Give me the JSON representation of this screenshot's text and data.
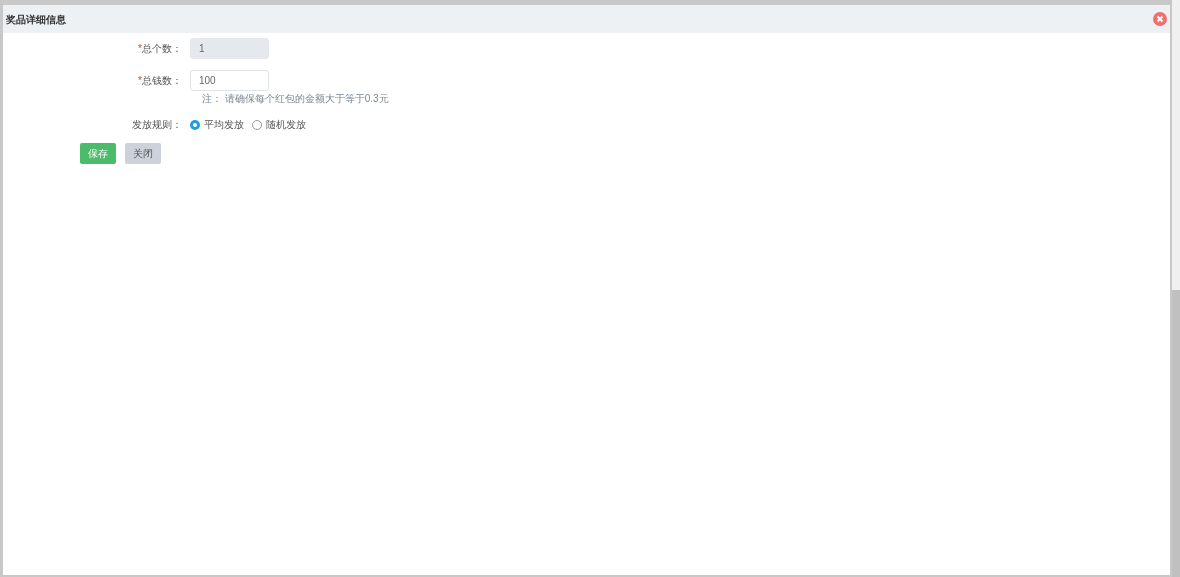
{
  "dialog": {
    "title": "奖品详细信息"
  },
  "fields": [
    {
      "label": "总个数：",
      "required_mark": "*",
      "value": "1",
      "disabled": true
    },
    {
      "label": "总钱数：",
      "required_mark": "*",
      "value": "100",
      "disabled": false,
      "note": "注：  请确保每个红包的金额大于等于0.3元"
    }
  ],
  "rule": {
    "label": "发放规则：",
    "options": [
      {
        "label": "平均发放",
        "selected": true
      },
      {
        "label": "随机发放",
        "selected": false
      }
    ]
  },
  "buttons": [
    {
      "label": "保存",
      "kind": "primary"
    },
    {
      "label": "关闭",
      "kind": "secondary"
    }
  ]
}
